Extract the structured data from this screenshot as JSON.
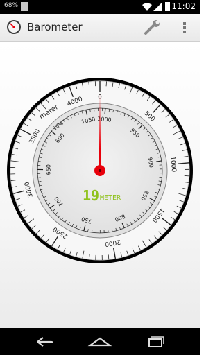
{
  "status_bar": {
    "battery_percent": "68%",
    "time": "11:02"
  },
  "app_bar": {
    "title": "Barometer"
  },
  "gauge": {
    "outer_ring_labels": [
      "0",
      "500",
      "1000",
      "1500",
      "2000",
      "2500",
      "3000",
      "3500",
      "4000"
    ],
    "outer_ring_unit": "meter",
    "inner_ring_labels": [
      "1000",
      "950",
      "900",
      "850",
      "800",
      "750",
      "700",
      "650",
      "600",
      "1050"
    ],
    "inner_ring_unit": "hPa",
    "digital_value": "19",
    "digital_unit": "METER",
    "needle_altitude_m": 19,
    "colors": {
      "needle": "#e8000b",
      "digital_text": "#8fc21c",
      "bezel": "#000000"
    }
  },
  "nav_bar": {
    "back_icon": "back-icon",
    "home_icon": "home-icon",
    "recents_icon": "recents-icon"
  }
}
